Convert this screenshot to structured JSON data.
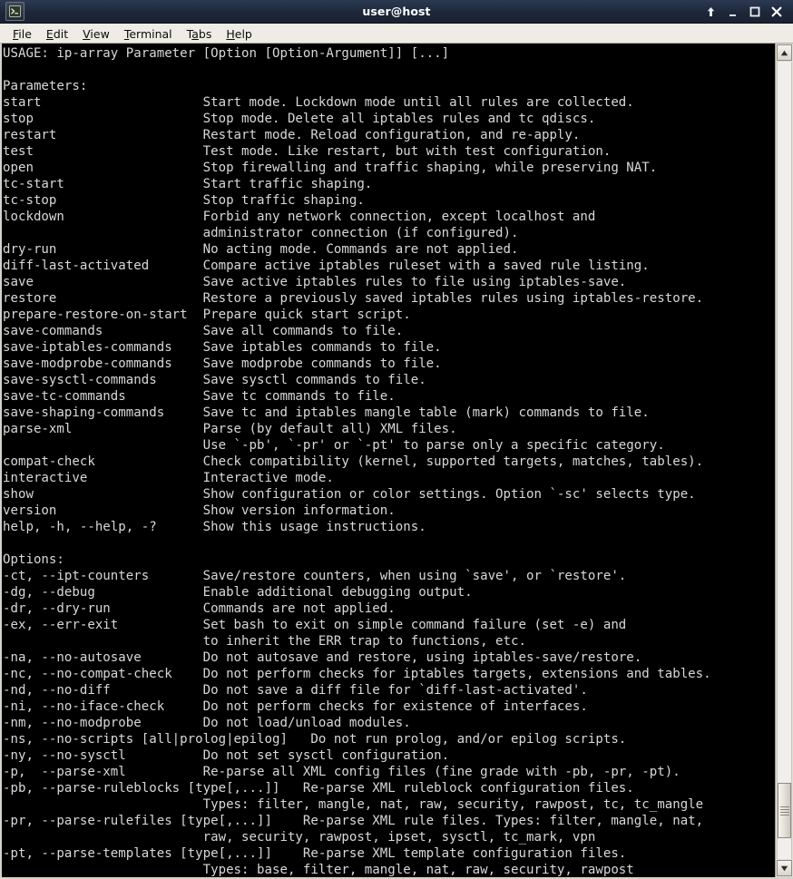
{
  "window": {
    "title": "user@host",
    "icon": "terminal-icon",
    "controls": [
      {
        "name": "shade-button",
        "glyph": "arrow-up"
      },
      {
        "name": "minimize-button",
        "glyph": "minimize"
      },
      {
        "name": "maximize-button",
        "glyph": "maximize"
      },
      {
        "name": "close-button",
        "glyph": "close"
      }
    ]
  },
  "menubar": {
    "items": [
      {
        "name": "menu-file",
        "label": "File",
        "mnemonic": "F"
      },
      {
        "name": "menu-edit",
        "label": "Edit",
        "mnemonic": "E"
      },
      {
        "name": "menu-view",
        "label": "View",
        "mnemonic": "V"
      },
      {
        "name": "menu-terminal",
        "label": "Terminal",
        "mnemonic": "T"
      },
      {
        "name": "menu-tabs",
        "label": "Tabs",
        "mnemonic": "a"
      },
      {
        "name": "menu-help",
        "label": "Help",
        "mnemonic": "H"
      }
    ]
  },
  "terminal": {
    "foreground": "#d8d8d8",
    "background": "#000000",
    "lines": [
      "USAGE: ip-array Parameter [Option [Option-Argument]] [...]",
      "",
      "Parameters:",
      "start                     Start mode. Lockdown mode until all rules are collected.",
      "stop                      Stop mode. Delete all iptables rules and tc qdiscs.",
      "restart                   Restart mode. Reload configuration, and re-apply.",
      "test                      Test mode. Like restart, but with test configuration.",
      "open                      Stop firewalling and traffic shaping, while preserving NAT.",
      "tc-start                  Start traffic shaping.",
      "tc-stop                   Stop traffic shaping.",
      "lockdown                  Forbid any network connection, except localhost and",
      "                          administrator connection (if configured).",
      "dry-run                   No acting mode. Commands are not applied.",
      "diff-last-activated       Compare active iptables ruleset with a saved rule listing.",
      "save                      Save active iptables rules to file using iptables-save.",
      "restore                   Restore a previously saved iptables rules using iptables-restore.",
      "prepare-restore-on-start  Prepare quick start script.",
      "save-commands             Save all commands to file.",
      "save-iptables-commands    Save iptables commands to file.",
      "save-modprobe-commands    Save modprobe commands to file.",
      "save-sysctl-commands      Save sysctl commands to file.",
      "save-tc-commands          Save tc commands to file.",
      "save-shaping-commands     Save tc and iptables mangle table (mark) commands to file.",
      "parse-xml                 Parse (by default all) XML files.",
      "                          Use `-pb', `-pr' or `-pt' to parse only a specific category.",
      "compat-check              Check compatibility (kernel, supported targets, matches, tables).",
      "interactive               Interactive mode.",
      "show                      Show configuration or color settings. Option `-sc' selects type.",
      "version                   Show version information.",
      "help, -h, --help, -?      Show this usage instructions.",
      "",
      "Options:",
      "-ct, --ipt-counters       Save/restore counters, when using `save', or `restore'.",
      "-dg, --debug              Enable additional debugging output.",
      "-dr, --dry-run            Commands are not applied.",
      "-ex, --err-exit           Set bash to exit on simple command failure (set -e) and",
      "                          to inherit the ERR trap to functions, etc.",
      "-na, --no-autosave        Do not autosave and restore, using iptables-save/restore.",
      "-nc, --no-compat-check    Do not perform checks for iptables targets, extensions and tables.",
      "-nd, --no-diff            Do not save a diff file for `diff-last-activated'.",
      "-ni, --no-iface-check     Do not perform checks for existence of interfaces.",
      "-nm, --no-modprobe        Do not load/unload modules.",
      "-ns, --no-scripts [all|prolog|epilog]   Do not run prolog, and/or epilog scripts.",
      "-ny, --no-sysctl          Do not set sysctl configuration.",
      "-p,  --parse-xml          Re-parse all XML config files (fine grade with -pb, -pr, -pt).",
      "-pb, --parse-ruleblocks [type[,...]]   Re-parse XML ruleblock configuration files.",
      "                          Types: filter, mangle, nat, raw, security, rawpost, tc, tc_mangle",
      "-pr, --parse-rulefiles [type[,...]]    Re-parse XML rule files. Types: filter, mangle, nat,",
      "                          raw, security, rawpost, ipset, sysctl, tc_mark, vpn",
      "-pt, --parse-templates [type[,...]]    Re-parse XML template configuration files.",
      "                          Types: base, filter, mangle, nat, raw, security, rawpost"
    ]
  },
  "scrollbar": {
    "up_button": "scroll-up-arrow",
    "down_button": "scroll-down-arrow",
    "thumb_position_percent": 90.5,
    "thumb_size_percent": 6.9
  }
}
